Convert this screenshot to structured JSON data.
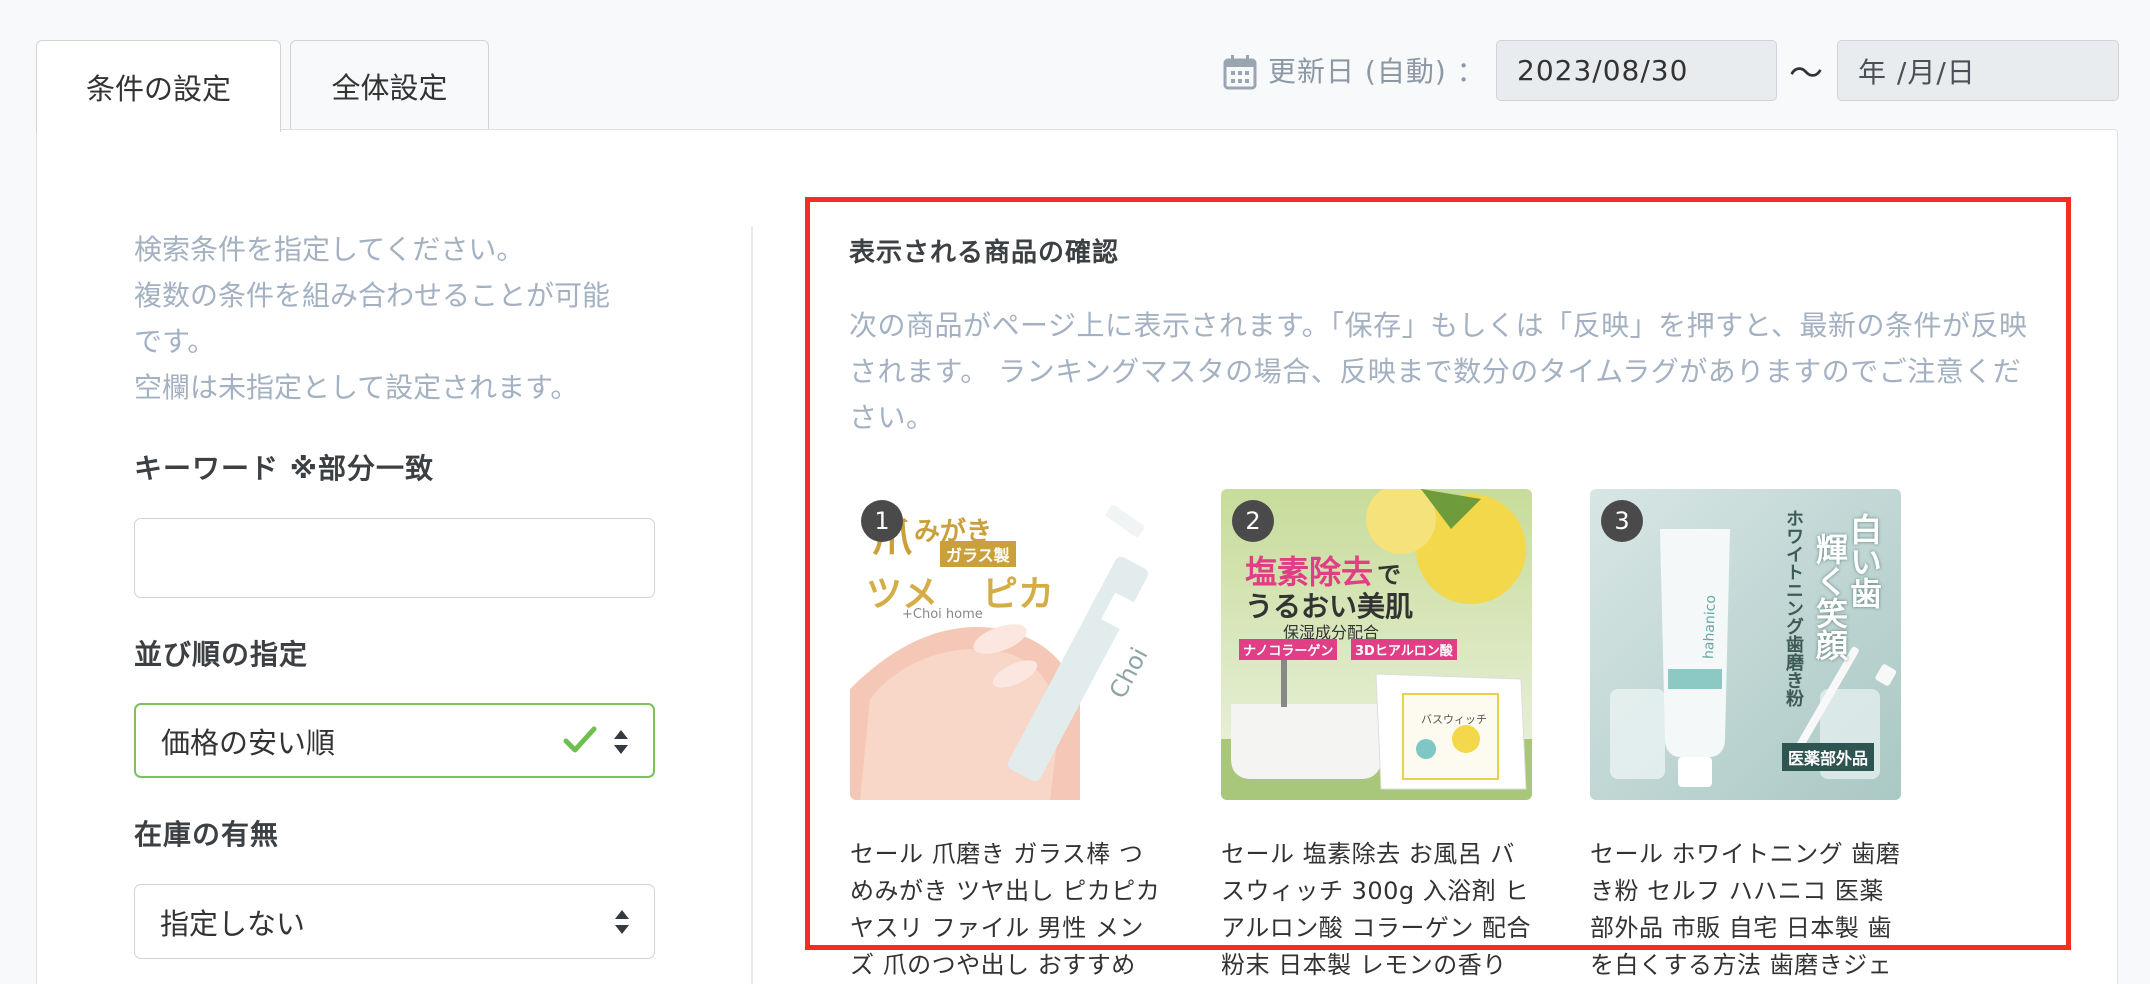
{
  "tabs": [
    {
      "label": "条件の設定",
      "active": true
    },
    {
      "label": "全体設定",
      "active": false
    }
  ],
  "date": {
    "label": "更新日 (自動) ：",
    "from": "2023/08/30",
    "separator": "〜",
    "to": "年 /月/日"
  },
  "left": {
    "help_lines": [
      "検索条件を指定してください。",
      "複数の条件を組み合わせることが可能",
      "です。",
      "空欄は未指定として設定されます。"
    ],
    "keyword_label": "キーワード ※部分一致",
    "keyword_value": "",
    "sort_label": "並び順の指定",
    "sort_value": "価格の安い順",
    "stock_label": "在庫の有無",
    "stock_value": "指定しない"
  },
  "preview": {
    "title": "表示される商品の確認",
    "description": "次の商品がページ上に表示されます。「保存」もしくは「反映」を押すと、最新の条件が反映されます。 ランキングマスタの場合、反映まで数分のタイムラグがありますのでご注意ください。",
    "products": [
      {
        "rank": "1",
        "title": "セール 爪磨き ガラス棒 つめみがき ツヤ出し ピカピカ ヤスリ ファイル 男性 メンズ 爪のつや出し おすすめ プラス",
        "image_text": [
          "爪",
          "みがき",
          "ガラス製",
          "ツメ",
          "ピカ",
          "+Choi home",
          "Choi"
        ]
      },
      {
        "rank": "2",
        "title": "セール 塩素除去 お風呂 バスウィッチ 300g 入浴剤 ヒアルロン酸 コラーゲン 配合 粉末 日本製 レモンの香り おふ",
        "image_text": [
          "塩素除去",
          "で",
          "うるおい美肌",
          "保湿成分配合",
          "ナノコラーゲン",
          "3Dヒアルロン酸",
          "バスウィッチ"
        ]
      },
      {
        "rank": "3",
        "title": "セール ホワイトニング 歯磨き粉 セルフ ハハニコ 医薬部外品 市販 自宅 日本製 歯を白くする方法 歯磨きジェル フ",
        "image_text": [
          "白い歯",
          "輝く笑顔",
          "ホワイトニング歯磨き粉",
          "医薬部外品",
          "hahanico"
        ]
      }
    ]
  },
  "colors": {
    "accent_highlight": "#f32d1f",
    "help_text": "#a3b1c2",
    "valid_border": "#7cc15a"
  }
}
